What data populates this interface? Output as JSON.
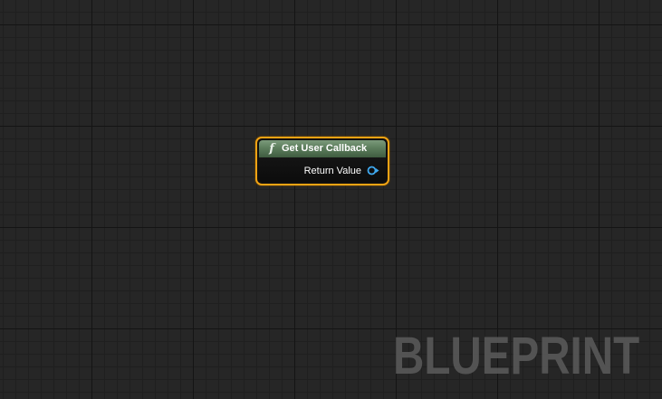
{
  "node": {
    "title": "Get User Callback",
    "icon": "function-icon",
    "icon_glyph": "f",
    "output_pin": {
      "label": "Return Value",
      "icon": "delegate-pin-icon",
      "color": "#3fa9ef"
    },
    "header_color": "#5c7d5c",
    "border_color": "#f2a313"
  },
  "watermark": "BLUEPRINT"
}
